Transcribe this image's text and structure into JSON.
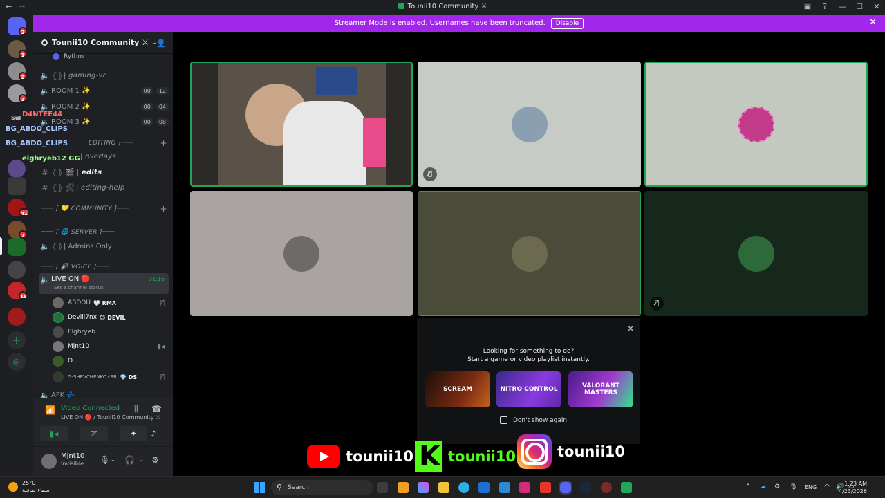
{
  "titlebar": {
    "title": "Tounii10 Community ⚔"
  },
  "banner": {
    "text": "Streamer Mode is enabled. Usernames have been truncated.",
    "button": "Disable"
  },
  "server": {
    "name": "Tounii10 Community ⚔"
  },
  "channels": {
    "rythm": "Rythm",
    "gaming_vc": "| gaming-vc",
    "room1": "ROOM 1 ✨",
    "room2": "ROOM 2 ✨",
    "room3": "ROOM 3 ✨",
    "room1_counts": [
      "00",
      "12"
    ],
    "room2_counts": [
      "00",
      "04"
    ],
    "room3_counts": [
      "00",
      "08"
    ],
    "editing_cat": "EDITING ]───",
    "overlays": "| overlays",
    "edits": "| edits",
    "editing_help": "| editing-help",
    "community_cat": "─── [ 💛 COMMUNITY ]───",
    "server_cat": "─── [ 🌐 SERVER ]───",
    "admins_only": "| Admins Only",
    "voice_cat": "─── [ 🔊 VOICE ]───",
    "live_on": "LIVE ON 🔴",
    "live_status": "Set a channel status",
    "live_timer": "31:16",
    "afk": "AFK 💤"
  },
  "voice_users": [
    {
      "name": "ABDOU",
      "tag": "🤍 RMA"
    },
    {
      "name": "Devill7nx",
      "tag": "😈 DEVIL"
    },
    {
      "name": "Elghryeb",
      "tag": ""
    },
    {
      "name": "Mjnt10",
      "tag": ""
    },
    {
      "name": "O...",
      "tag": ""
    },
    {
      "name": "G-SHEVCHENKO⚡BR",
      "tag": "💎 DS"
    }
  ],
  "overlay_names": {
    "n1": "D4NTEE44",
    "n2": "BG_ABDO_CLIPS",
    "n3": "BG_ABDO_CLIPS",
    "n4": "elghryeb12 GG",
    "n5": "Sul"
  },
  "voice_panel": {
    "status": "Video Connected",
    "channel": "LIVE ON 🔴 / Tounii10 Community ⚔"
  },
  "user_panel": {
    "name": "Mjnt10",
    "status": "Invisible"
  },
  "activity_popup": {
    "line1": "Looking for something to do?",
    "line2": "Start a game or video playlist instantly.",
    "cards": [
      "SCREAM",
      "NITRO CONTROL",
      "VALORANT MASTERS"
    ],
    "checkbox": "Don't show again"
  },
  "social": {
    "youtube": "tounii10",
    "kick": "tounii10",
    "instagram": "tounii10"
  },
  "guild_badges": [
    "2",
    "1",
    "2",
    "3",
    "41",
    "7",
    "18"
  ],
  "taskbar": {
    "weather_temp": "25°C",
    "weather_desc": "سماء صافية",
    "search": "Search",
    "lang": "ENG",
    "time": "1:23 AM",
    "date": "4/23/2026"
  },
  "colors": {
    "brand": "#5865f2",
    "streamer_banner": "#a128eb",
    "speaking": "#23a559",
    "mention": "#f23f43"
  }
}
